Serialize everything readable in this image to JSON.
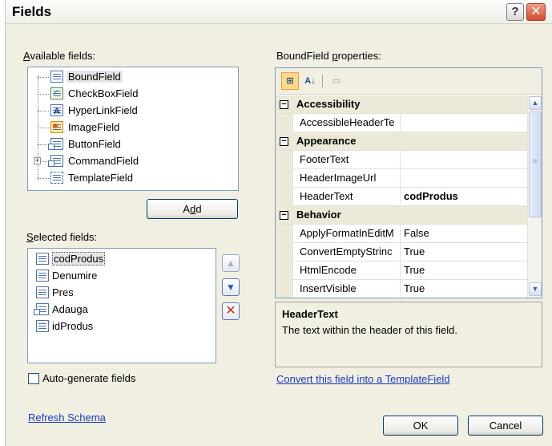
{
  "window": {
    "title": "Fields",
    "help_glyph": "?",
    "close_glyph": "✕"
  },
  "available_fields": {
    "label_accesskey": "A",
    "label_rest": "vailable fields:",
    "items": [
      {
        "label": "BoundField",
        "icon": "boundfield-icon"
      },
      {
        "label": "CheckBoxField",
        "icon": "checkboxfield-icon"
      },
      {
        "label": "HyperLinkField",
        "icon": "hyperlinkfield-icon"
      },
      {
        "label": "ImageField",
        "icon": "imagefield-icon"
      },
      {
        "label": "ButtonField",
        "icon": "buttonfield-icon"
      },
      {
        "label": "CommandField",
        "icon": "commandfield-icon"
      },
      {
        "label": "TemplateField",
        "icon": "templatefield-icon"
      }
    ],
    "selected": "BoundField",
    "expander_glyph": "+"
  },
  "add_button": {
    "pre": "A",
    "accesskey": "d",
    "post": "d"
  },
  "selected_fields": {
    "label_accesskey": "S",
    "label_rest": "elected fields:",
    "items": [
      "codProdus",
      "Denumire",
      "Pres",
      "Adauga",
      "idProdus"
    ],
    "selected": "codProdus"
  },
  "move_buttons": {
    "up_glyph": "▲",
    "down_glyph": "▼",
    "delete_glyph": "✕"
  },
  "auto_generate": {
    "pre": "Auto-",
    "accesskey": "g",
    "post": "enerate fields",
    "checked": false
  },
  "refresh_schema": "Refresh Schema",
  "properties": {
    "label_pre": "BoundField ",
    "label_accesskey": "p",
    "label_post": "roperties:",
    "toolbar": {
      "categorized": "⊞",
      "alphabetical": "A↓",
      "property_pages": "▭"
    },
    "collapse_glyph": "−",
    "rows": [
      {
        "kind": "category",
        "name": "Accessibility"
      },
      {
        "kind": "prop",
        "name": "AccessibleHeaderTe",
        "value": ""
      },
      {
        "kind": "category",
        "name": "Appearance"
      },
      {
        "kind": "prop",
        "name": "FooterText",
        "value": ""
      },
      {
        "kind": "prop",
        "name": "HeaderImageUrl",
        "value": ""
      },
      {
        "kind": "prop",
        "name": "HeaderText",
        "value": "codProdus",
        "selected": true
      },
      {
        "kind": "category",
        "name": "Behavior"
      },
      {
        "kind": "prop",
        "name": "ApplyFormatInEditM",
        "value": "False"
      },
      {
        "kind": "prop",
        "name": "ConvertEmptyStrinc",
        "value": "True"
      },
      {
        "kind": "prop",
        "name": "HtmlEncode",
        "value": "True"
      },
      {
        "kind": "prop",
        "name": "InsertVisible",
        "value": "True"
      }
    ],
    "scroll": {
      "up_glyph": "▲",
      "down_glyph": "▼"
    },
    "description": {
      "title": "HeaderText",
      "text": "The text within the header of this field."
    }
  },
  "convert_link": "Convert this field into a TemplateField",
  "ok_button": "OK",
  "cancel_button": "Cancel",
  "colors": {
    "dialog_bg": "#f1efe2",
    "link": "#1a3ac8",
    "border": "#7f9db9",
    "close_red": "#d24b2e"
  }
}
